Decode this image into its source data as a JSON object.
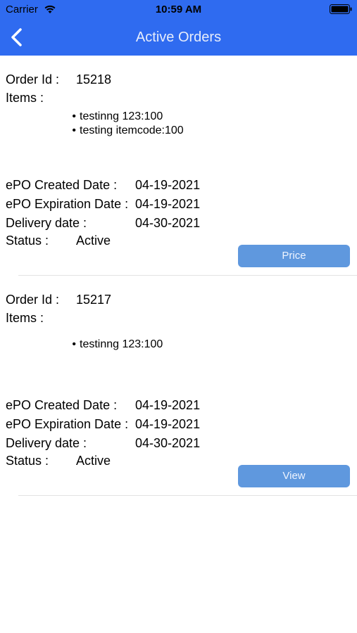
{
  "status_bar": {
    "carrier": "Carrier",
    "time": "10:59 AM"
  },
  "nav": {
    "title": "Active Orders"
  },
  "labels": {
    "order_id": "Order Id :",
    "items": "Items :",
    "created": "ePO Created Date :",
    "expiration": "ePO Expiration Date :",
    "delivery": "Delivery date :",
    "status": "Status :"
  },
  "orders": [
    {
      "id": "15218",
      "items": [
        "testinng 123:100",
        "testing itemcode:100"
      ],
      "created": "04-19-2021",
      "expiration": "04-19-2021",
      "delivery": "04-30-2021",
      "status": "Active",
      "button": "Price"
    },
    {
      "id": "15217",
      "items": [
        "testinng 123:100"
      ],
      "created": "04-19-2021",
      "expiration": "04-19-2021",
      "delivery": "04-30-2021",
      "status": "Active",
      "button": "View"
    }
  ],
  "colors": {
    "nav_bg": "#2f6bf0",
    "button_bg": "#5f98de",
    "divider": "#e2e2e2"
  },
  "icons": [
    "wifi-icon",
    "battery-icon",
    "back-chevron-icon"
  ]
}
